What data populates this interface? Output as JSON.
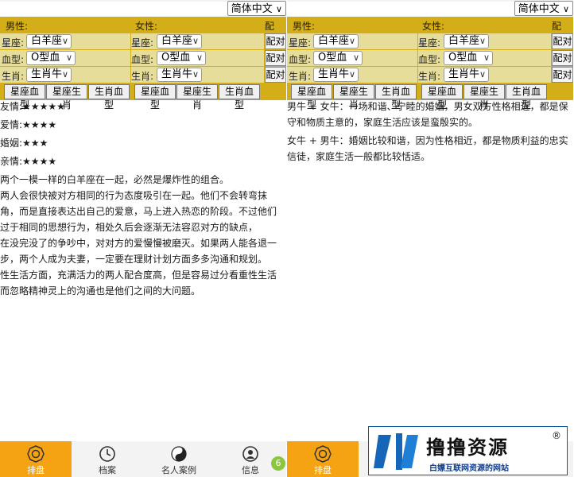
{
  "left": {
    "language": "简体中文",
    "header": {
      "male": "男性:",
      "female": "女性:",
      "pair": "配对:"
    },
    "rows": [
      {
        "label": "星座:",
        "male_value": "白羊座",
        "female_value": "白羊座",
        "pair_button": "配对"
      },
      {
        "label": "血型:",
        "male_value": "O型血",
        "female_value": "O型血",
        "pair_button": "配对"
      },
      {
        "label": "生肖:",
        "male_value": "生肖牛",
        "female_value": "生肖牛",
        "pair_button": "配对"
      }
    ],
    "male_buttons": [
      "星座血型",
      "星座生肖",
      "生肖血型"
    ],
    "female_buttons": [
      "星座血型",
      "星座生肖",
      "生肖血型"
    ],
    "ratings": [
      {
        "label": "友情:",
        "stars": "★★★★★"
      },
      {
        "label": "爱情:",
        "stars": "★★★★"
      },
      {
        "label": "婚姻:",
        "stars": "★★★"
      },
      {
        "label": "亲情:",
        "stars": "★★★★"
      }
    ],
    "paragraphs": [
      "两个一模一样的白羊座在一起，必然是爆炸性的组合。",
      "两人会很快被对方相同的行为态度吸引在一起。他们不会转弯抹角，而是直接表达出自己的爱意，马上进入热恋的阶段。不过他们过于相同的思想行为，相处久后会逐渐无法容忍对方的缺点，",
      "在没完没了的争吵中，对对方的爱慢慢被磨灭。如果两人能各退一步，两个人成为夫妻，一定要在理财计划方面多多沟通和规划。",
      "性生活方面，充满活力的两人配合度高，但是容易过分看重性生活而忽略精神灵上的沟通也是他们之间的大问题。"
    ]
  },
  "right": {
    "language": "简体中文",
    "header": {
      "male": "男性:",
      "female": "女性:",
      "pair": "配对:"
    },
    "rows": [
      {
        "label": "星座:",
        "male_value": "白羊座",
        "female_value": "白羊座",
        "pair_button": "配对"
      },
      {
        "label": "血型:",
        "male_value": "O型血",
        "female_value": "O型血",
        "pair_button": "配对"
      },
      {
        "label": "生肖:",
        "male_value": "生肖牛",
        "female_value": "生肖牛",
        "pair_button": "配对"
      }
    ],
    "male_buttons": [
      "星座血型",
      "星座生肖",
      "生肖血型"
    ],
    "female_buttons": [
      "星座血型",
      "星座生肖",
      "生肖血型"
    ],
    "paragraphs": [
      "男牛 + 女牛：一场和谐、宁睦的婚姻，男女双方性格相近，都是保守和物质主意的，家庭生活应该是蛮殷实的。",
      "女牛 + 男牛：婚姻比较和谐，因为性格相近，都是物质利益的忠实信徒，家庭生活一般都比较恬适。"
    ]
  },
  "nav": {
    "items": [
      {
        "label": "排盘",
        "icon": "bagua-icon"
      },
      {
        "label": "档案",
        "icon": "clock-icon"
      },
      {
        "label": "名人案例",
        "icon": "yin-yang-icon"
      },
      {
        "label": "信息",
        "icon": "person-icon"
      }
    ],
    "right_items": [
      {
        "label": "排盘",
        "icon": "bagua-icon"
      }
    ],
    "badge": "6"
  },
  "watermark": {
    "title": "撸撸资源",
    "reg": "®",
    "subtitle": "白嫖互联网资源的网站"
  },
  "colors": {
    "header_gold": "#d4ae18",
    "cell_khaki": "#e6dd9a",
    "nav_active": "#f6a313",
    "badge_green": "#8cc63f",
    "watermark_blue": "#0d5a9a"
  }
}
